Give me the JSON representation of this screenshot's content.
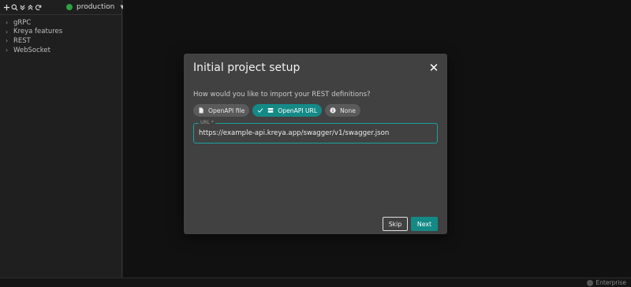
{
  "sidebar": {
    "environment": {
      "label": "production",
      "status_color": "#2ea043"
    },
    "toolbar_icons": [
      "add-icon",
      "search-icon",
      "expand-all-icon",
      "collapse-all-icon",
      "refresh-icon"
    ],
    "tree_items": [
      {
        "label": "gRPC"
      },
      {
        "label": "Kreya features"
      },
      {
        "label": "REST"
      },
      {
        "label": "WebSocket"
      }
    ]
  },
  "dialog": {
    "title": "Initial project setup",
    "question": "How would you like to import your REST definitions?",
    "options": [
      {
        "label": "OpenAPI file",
        "icon": "file-icon",
        "selected": false
      },
      {
        "label": "OpenAPI URL",
        "icon": "server-icon",
        "selected": true
      },
      {
        "label": "None",
        "icon": "info-icon",
        "selected": false
      }
    ],
    "url_field": {
      "label": "URL *",
      "value": "https://example-api.kreya.app/swagger/v1/swagger.json"
    },
    "skip_label": "Skip",
    "next_label": "Next"
  },
  "statusbar": {
    "edition": "Enterprise"
  },
  "colors": {
    "accent": "#148a87",
    "focus_border": "#1aa19c"
  }
}
